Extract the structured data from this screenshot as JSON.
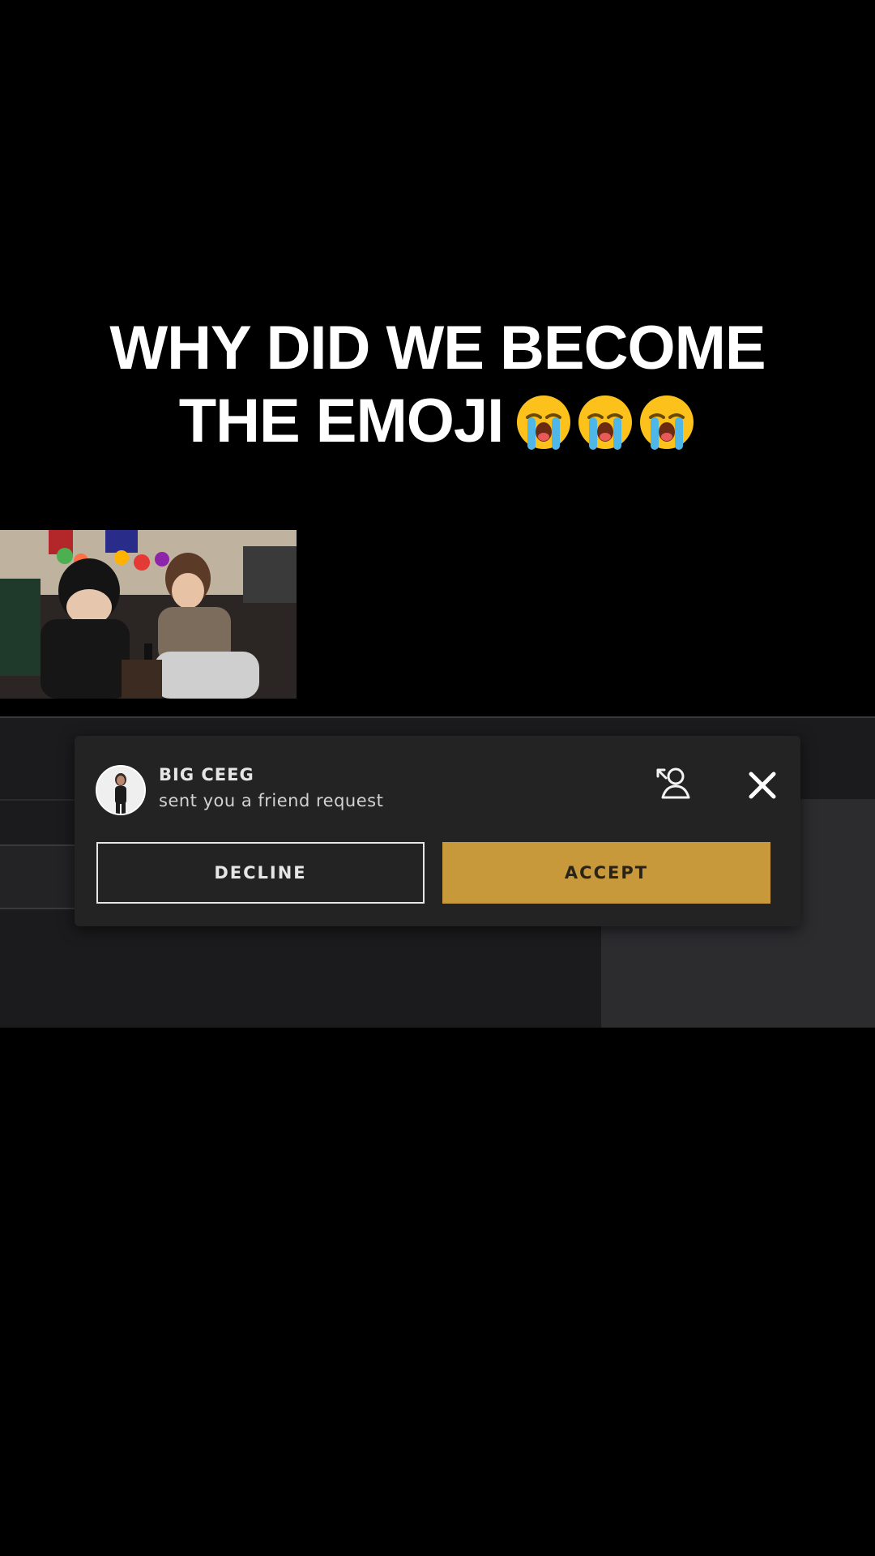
{
  "caption": {
    "line1": "WHY DID WE BECOME",
    "line2": "THE EMOJI",
    "emojis": [
      "loudly-crying-face",
      "loudly-crying-face",
      "loudly-crying-face"
    ]
  },
  "notification": {
    "username": "BIG CEEG",
    "message": "sent you a friend request",
    "decline_label": "DECLINE",
    "accept_label": "ACCEPT",
    "icons": [
      "friend-request-icon",
      "close-icon"
    ]
  },
  "colors": {
    "accept": "#c8993b",
    "toast_bg": "#232324",
    "background": "#000000"
  }
}
